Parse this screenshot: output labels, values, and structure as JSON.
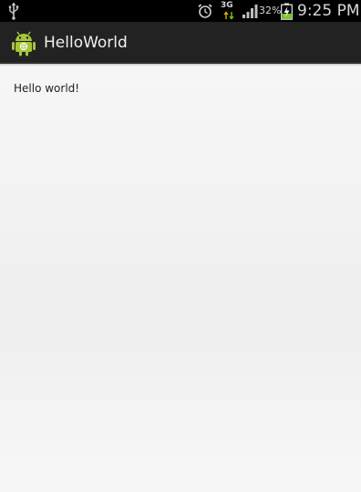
{
  "status_bar": {
    "icons": [
      "usb-icon",
      "alarm-icon",
      "network-3g-icon",
      "signal-icon",
      "battery-charging-icon"
    ],
    "network_type": "3G",
    "battery_percent": "32%",
    "time": "9:25 PM"
  },
  "action_bar": {
    "title": "HelloWorld",
    "icon": "android-icon"
  },
  "content": {
    "text": "Hello world!"
  },
  "colors": {
    "status_bar_bg": "#000000",
    "action_bar_bg": "#222222",
    "content_bg": "#f4f4f4",
    "android_green": "#a4c639",
    "battery_green": "#7ccd1a"
  }
}
